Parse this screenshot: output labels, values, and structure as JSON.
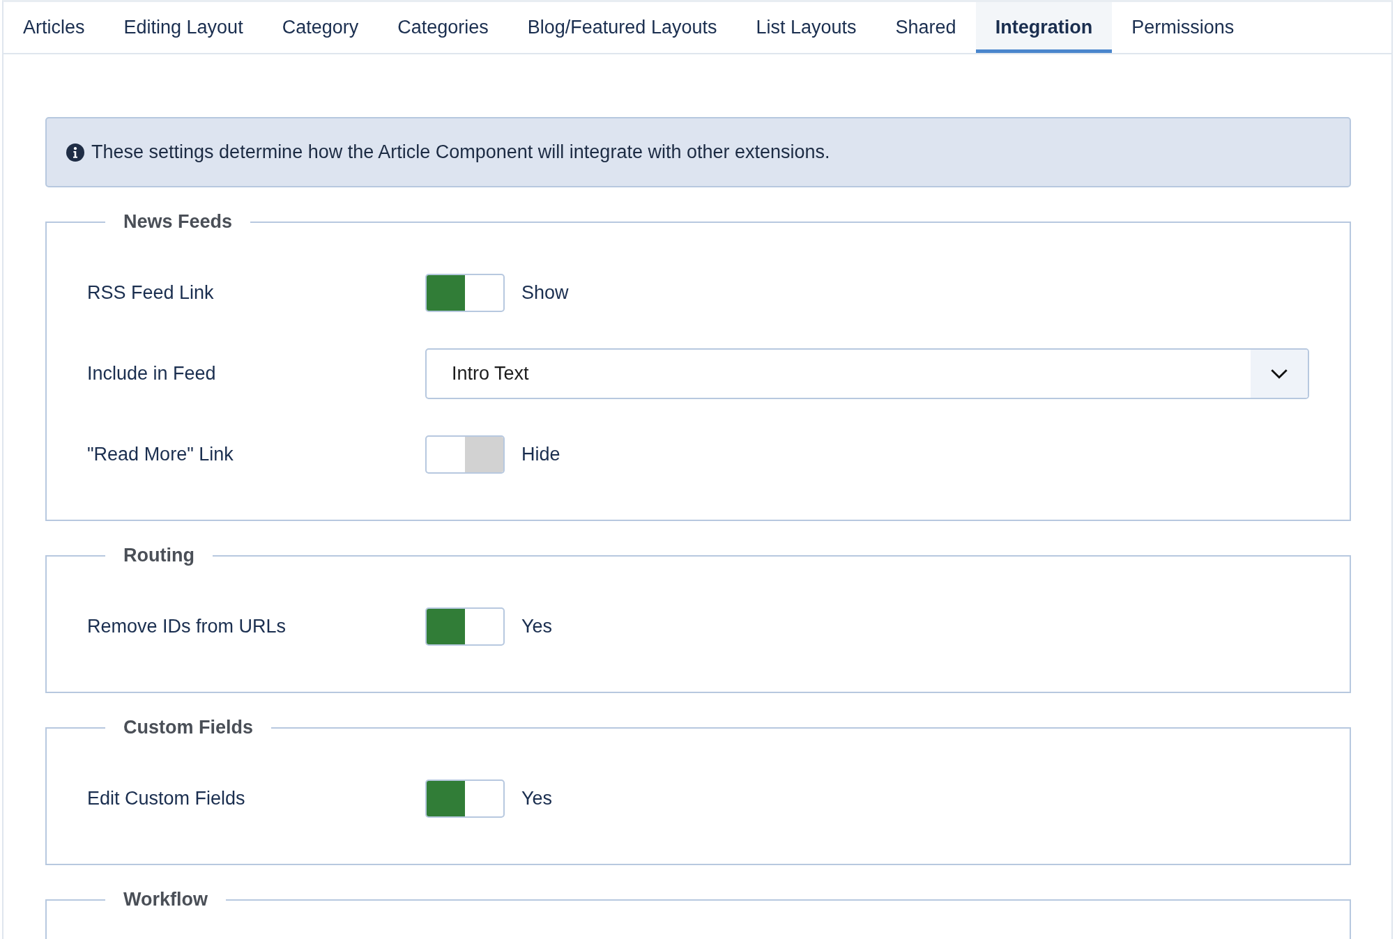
{
  "tabs": [
    {
      "label": "Articles",
      "selected": false
    },
    {
      "label": "Editing Layout",
      "selected": false
    },
    {
      "label": "Category",
      "selected": false
    },
    {
      "label": "Categories",
      "selected": false
    },
    {
      "label": "Blog/Featured Layouts",
      "selected": false
    },
    {
      "label": "List Layouts",
      "selected": false
    },
    {
      "label": "Shared",
      "selected": false
    },
    {
      "label": "Integration",
      "selected": true
    },
    {
      "label": "Permissions",
      "selected": false
    }
  ],
  "alert": {
    "text": "These settings determine how the Article Component will integrate with other extensions."
  },
  "fieldsets": [
    {
      "legend": "News Feeds",
      "fields": [
        {
          "kind": "toggle",
          "label": "RSS Feed Link",
          "on": true,
          "state_label": "Show"
        },
        {
          "kind": "select",
          "label": "Include in Feed",
          "value": "Intro Text"
        },
        {
          "kind": "toggle",
          "label": "\"Read More\" Link",
          "on": false,
          "state_label": "Hide"
        }
      ]
    },
    {
      "legend": "Routing",
      "fields": [
        {
          "kind": "toggle",
          "label": "Remove IDs from URLs",
          "on": true,
          "state_label": "Yes"
        }
      ]
    },
    {
      "legend": "Custom Fields",
      "fields": [
        {
          "kind": "toggle",
          "label": "Edit Custom Fields",
          "on": true,
          "state_label": "Yes"
        }
      ]
    },
    {
      "legend": "Workflow"
    }
  ]
}
